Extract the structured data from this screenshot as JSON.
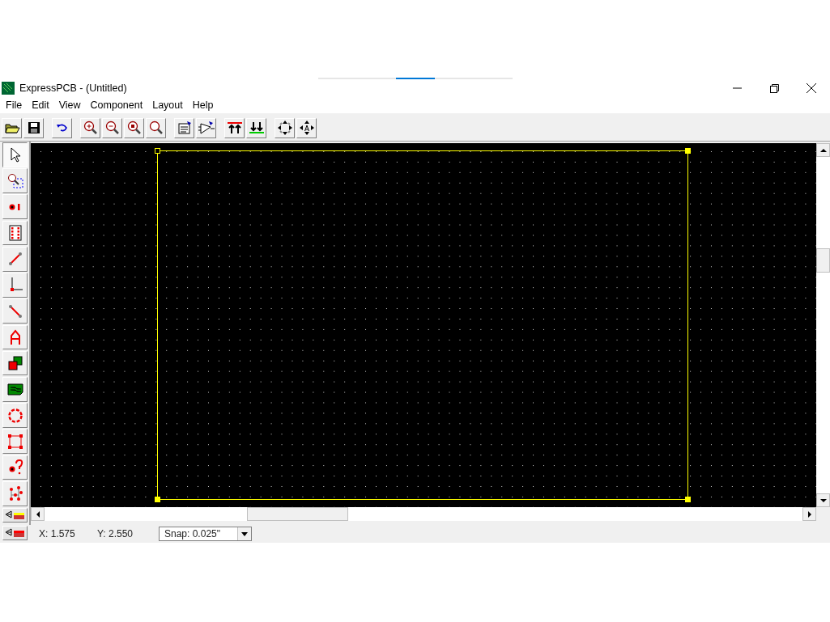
{
  "window": {
    "title": "ExpressPCB - (Untitled)"
  },
  "menu": [
    "File",
    "Edit",
    "View",
    "Component",
    "Layout",
    "Help"
  ],
  "tools": [
    {
      "selected": true
    },
    {
      "selected": false
    },
    {
      "selected": false
    },
    {
      "selected": false
    },
    {
      "selected": false
    },
    {
      "selected": false
    },
    {
      "selected": false
    },
    {
      "selected": false
    },
    {
      "selected": false
    },
    {
      "selected": false
    },
    {
      "selected": false
    },
    {
      "selected": false
    },
    {
      "selected": false
    },
    {
      "selected": false
    }
  ],
  "layers": [
    {
      "color": "#ffff00"
    },
    {
      "color": "#ff0000"
    }
  ],
  "status_bar": {
    "x": "X: 1.575",
    "y": "Y: 2.550",
    "snap": "Snap:  0.025\""
  }
}
